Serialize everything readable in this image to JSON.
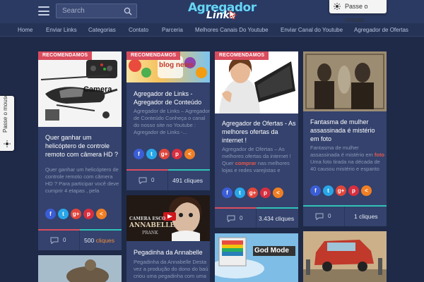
{
  "header": {
    "search": {
      "placeholder": "Search"
    },
    "logo": {
      "line1": "Agregador",
      "line2": "Links"
    },
    "passe_mouse": "Passe o mouse"
  },
  "nav": {
    "items": [
      {
        "label": "Home"
      },
      {
        "label": "Enviar Links"
      },
      {
        "label": "Categorias"
      },
      {
        "label": "Contato"
      },
      {
        "label": "Parceria"
      },
      {
        "label": "Melhores Canais Do Youtube"
      },
      {
        "label": "Enviar Canal do Youtube"
      },
      {
        "label": "Agregador de Ofertas"
      }
    ]
  },
  "side_widget": {
    "label": "Passe o mouse"
  },
  "colors": {
    "background": "#1f2a48",
    "card": "#34426d",
    "badge": "#d94c5e",
    "accent_teal": "#2fc3b7",
    "clicks_orange": "#ef8c3a"
  },
  "share_icons": [
    "facebook-icon",
    "twitter-icon",
    "google-plus-icon",
    "pinterest-icon",
    "share-icon"
  ],
  "share_glyphs": {
    "facebook": "f",
    "twitter": "t",
    "google_plus": "g+",
    "pinterest": "p",
    "share": "<"
  },
  "cards": [
    {
      "badge": "RECOMENDAMOS",
      "thumb_text": "Camera",
      "title": "Quer ganhar um helicóptero de controle remoto com câmera HD ?",
      "excerpt": "Quer ganhar um helicóptero de controle remoto com câmera HD ? Para participar você deve cumprir 4 etapas , pela",
      "comments": "0",
      "clicks": "500",
      "clicks_word": "cliques"
    },
    {
      "badge": "RECOMENDAMOS",
      "thumb_text": "blog news",
      "title": "Agregador de Links - Agregador de Conteúdo",
      "excerpt": "Agregador de Links – Agregador de Conteúdo Conheça o canal do nosso site no Youtube : Agregador de Links -...",
      "comments": "0",
      "clicks": "491 cliques"
    },
    {
      "badge": "RECOMENDAMOS",
      "title": "Agregador de Ofertas - As melhores ofertas da internet !",
      "excerpt_a": "Agregador de Ofertas – As melhores ofertas da internet ! Quer ",
      "excerpt_hl": "comprar",
      "excerpt_b": " nas melhores lojas e redes varejistas e ainda...",
      "comments": "0",
      "clicks": "3.434 cliques"
    },
    {
      "title": "Fantasma de mulher assassinada é mistério em foto",
      "excerpt_a": "Fantasma de mulher assassinada é mistério em ",
      "excerpt_hl": "foto",
      "excerpt_b": " Uma foto tirada na década de 40 causou mistério e espanto em...",
      "comments": "0",
      "clicks": "1 cliques"
    },
    {
      "thumb_text_a": "CAMERA ESCO",
      "thumb_text_b": "ANNABELLE",
      "thumb_text_c": "PRANK",
      "title": "Pegadinha da Annabelle",
      "excerpt": "Pegadinha da Annabelle Desta vez a produção do dono do baú criou uma pegadinha com uma"
    },
    {
      "thumb_text": "God Mode"
    }
  ]
}
